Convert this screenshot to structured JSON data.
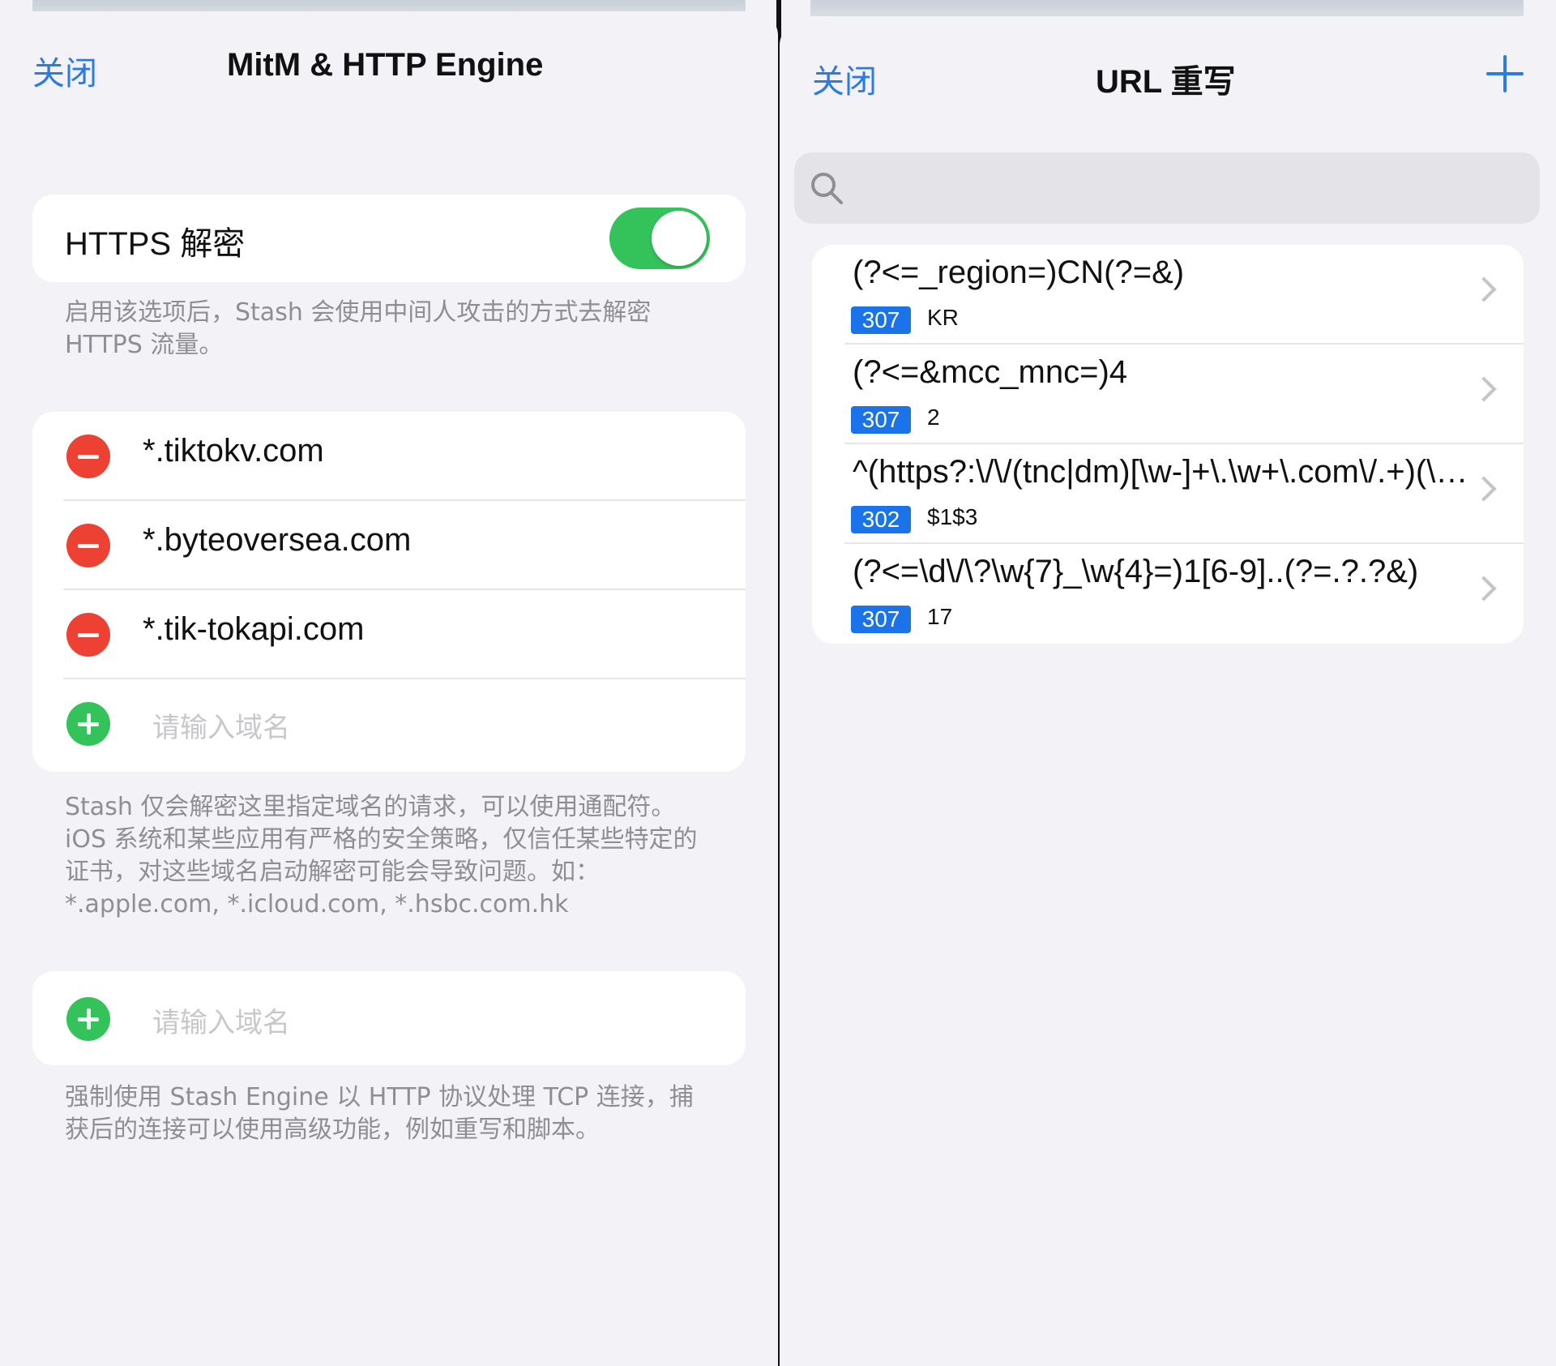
{
  "left_panel": {
    "close_label": "关闭",
    "title": "MitM & HTTP Engine",
    "https": {
      "label": "HTTPS 解密",
      "enabled": true,
      "footnote": "启用该选项后，Stash 会使用中间人攻击的方式去解密 HTTPS 流量。"
    },
    "domains": [
      "*.tiktokv.com",
      "*.byteoversea.com",
      "*.tik-tokapi.com"
    ],
    "domain_placeholder": "请输入域名",
    "domains_footnote": "Stash 仅会解密这里指定域名的请求，可以使用通配符。iOS 系统和某些应用有严格的安全策略，仅信任某些特定的证书，对这些域名启动解密可能会导致问题。如： *.apple.com, *.icloud.com, *.hsbc.com.hk",
    "engine_placeholder": "请输入域名",
    "engine_footnote": "强制使用 Stash Engine 以 HTTP 协议处理 TCP 连接，捕获后的连接可以使用高级功能，例如重写和脚本。"
  },
  "right_panel": {
    "close_label": "关闭",
    "title": "URL 重写",
    "add_icon": "plus-icon",
    "search_icon": "search-icon",
    "rules": [
      {
        "pattern": "(?<=_region=)CN(?=&)",
        "code": "307",
        "target": "KR"
      },
      {
        "pattern": "(?<=&mcc_mnc=)4",
        "code": "307",
        "target": "2"
      },
      {
        "pattern": "^(https?:\\/\\/(tnc|dm)[\\w-]+\\.\\w+\\.com\\/.+)(\\?)(.+)",
        "code": "302",
        "target": "$1$3"
      },
      {
        "pattern": "(?<=\\d\\/\\?\\w{7}_\\w{4}=)1[6-9]..(?=.?.?&)",
        "code": "307",
        "target": "17"
      }
    ]
  },
  "colors": {
    "accent": "#2c7be5",
    "toggle_on": "#34c35a",
    "delete": "#ec4133",
    "badge": "#1a73e8"
  }
}
